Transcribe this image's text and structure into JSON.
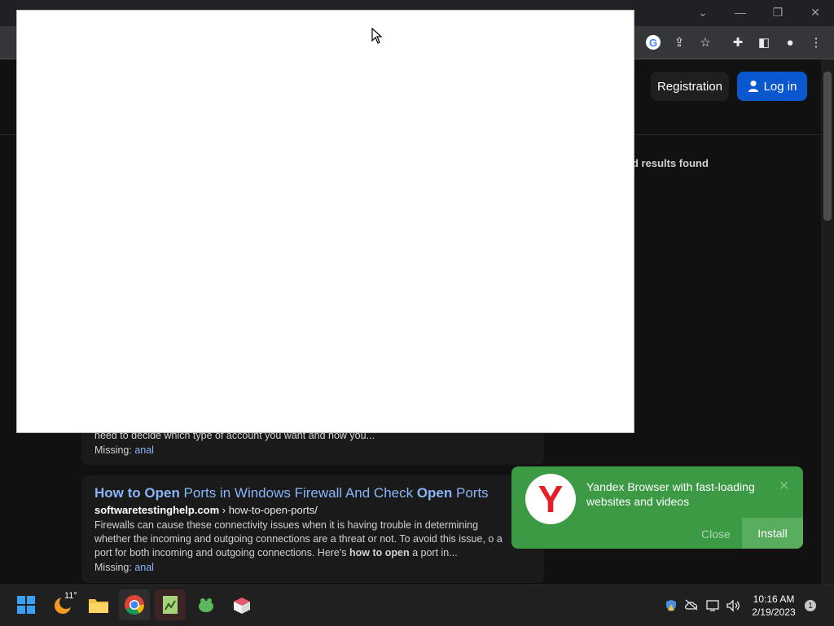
{
  "window": {
    "minimize": "—",
    "restore": "❐",
    "close": "✕",
    "tab_search": "⌄"
  },
  "toolbar": {
    "google_icon": "G",
    "share_icon": "⇪",
    "star_icon": "☆",
    "extensions_icon": "✚",
    "sidepanel_icon": "◧",
    "profile_icon": "●",
    "menu_icon": "⋮"
  },
  "site": {
    "registration_label": "Registration",
    "login_label": "Log in",
    "results_found": "d results found"
  },
  "results": [
    {
      "snippet_tail": "need to decide which type of account you want and how you...",
      "missing_label": "Missing:",
      "missing_term": "anal"
    },
    {
      "title_p1": "How to Open",
      "title_p2": " Ports in Windows Firewall And Check ",
      "title_p3": "Open",
      "title_p4": " Ports",
      "url_domain": "softwaretestinghelp.com",
      "url_path": " › how-to-open-ports/",
      "snippet_p1": "Firewalls can cause these connectivity issues when it is having trouble in determining whether the incoming and outgoing connections are a threat or not. To avoid this issue, o",
      "snippet_p2": "a port for both incoming and outgoing connections. Here's ",
      "snippet_bold": "how to open",
      "snippet_p3": " a port in...",
      "missing_label": "Missing:",
      "missing_term": "anal"
    }
  ],
  "toast": {
    "logo": "Y",
    "message": "Yandex Browser with fast-loading websites and videos",
    "dismiss": "✕",
    "close_label": "Close",
    "install_label": "Install"
  },
  "taskbar": {
    "weather_temp": "11°",
    "time": "10:16 AM",
    "date": "2/19/2023",
    "notifications": "1"
  },
  "colors": {
    "accent_blue": "#0b57d0",
    "toast_green": "#3c9a45",
    "link_blue": "#8ab4f8"
  }
}
